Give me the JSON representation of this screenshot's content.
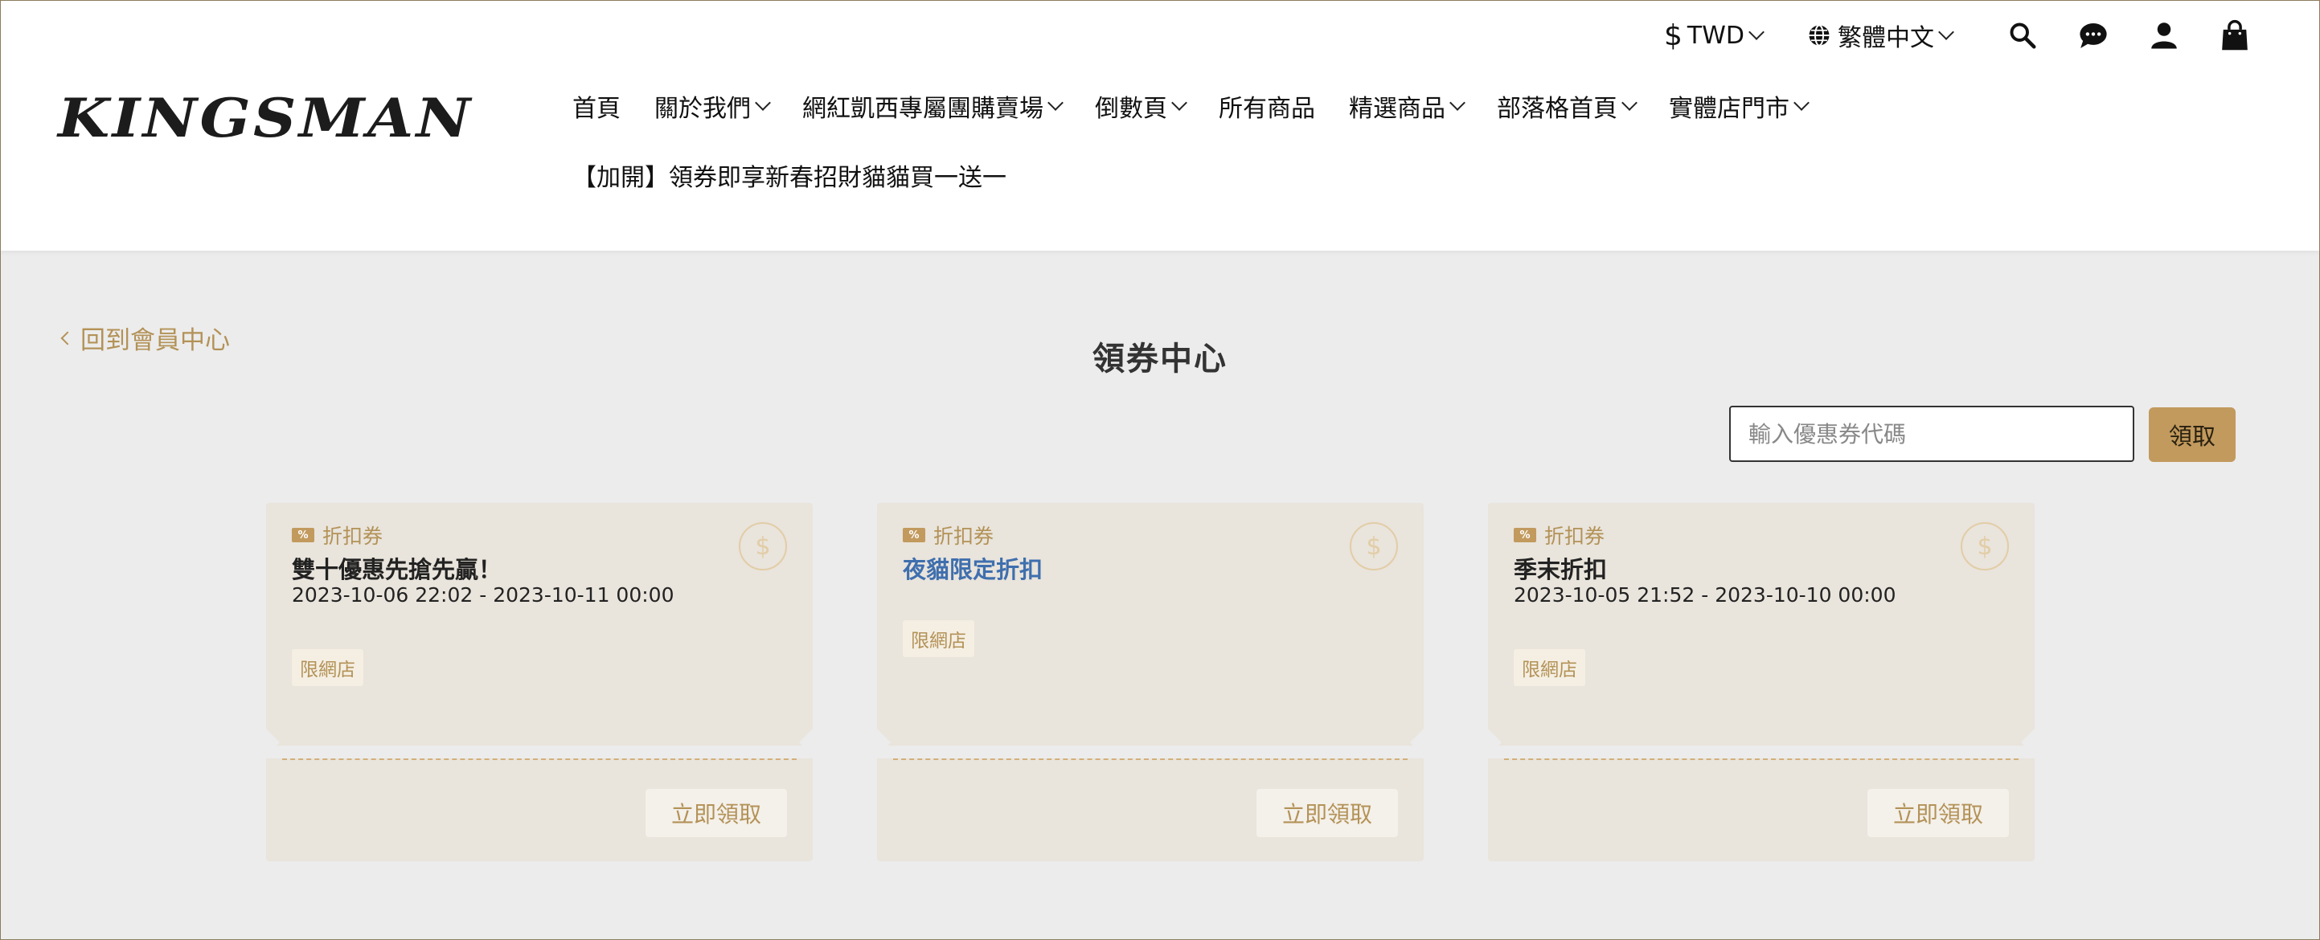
{
  "header": {
    "logo": "KINGSMAN",
    "currency": "TWD",
    "currency_symbol": "$",
    "language": "繁體中文",
    "icons": [
      "search-icon",
      "chat-icon",
      "user-icon",
      "cart-icon"
    ]
  },
  "nav": {
    "items": [
      {
        "label": "首頁",
        "dropdown": false
      },
      {
        "label": "關於我們",
        "dropdown": true
      },
      {
        "label": "網紅凱西專屬團購賣場",
        "dropdown": true
      },
      {
        "label": "倒數頁",
        "dropdown": true
      },
      {
        "label": "所有商品",
        "dropdown": false
      },
      {
        "label": "精選商品",
        "dropdown": true
      },
      {
        "label": "部落格首頁",
        "dropdown": true
      },
      {
        "label": "實體店門市",
        "dropdown": true
      }
    ],
    "row2": "【加開】領券即享新春招財貓貓買一送一"
  },
  "main": {
    "back_label": "回到會員中心",
    "title": "領券中心",
    "code_placeholder": "輸入優惠券代碼",
    "claim_label": "領取"
  },
  "coupons": [
    {
      "type": "折扣券",
      "title": "雙十優惠先搶先贏！",
      "date": "2023-10-06 22:02 - 2023-10-11 00:00",
      "tag": "限網店",
      "button": "立即領取",
      "title_color": "#222222"
    },
    {
      "type": "折扣券",
      "title": "夜貓限定折扣",
      "date": "",
      "tag": "限網店",
      "button": "立即領取",
      "title_color": "#3f6fae"
    },
    {
      "type": "折扣券",
      "title": "季末折扣",
      "date": "2023-10-05 21:52 - 2023-10-10 00:00",
      "tag": "限網店",
      "button": "立即領取",
      "title_color": "#222222"
    }
  ],
  "colors": {
    "accent": "#c29a5e",
    "accent_text": "#b39257",
    "page_bg": "#ececec",
    "coupon_bg": "#e9e4dc"
  }
}
